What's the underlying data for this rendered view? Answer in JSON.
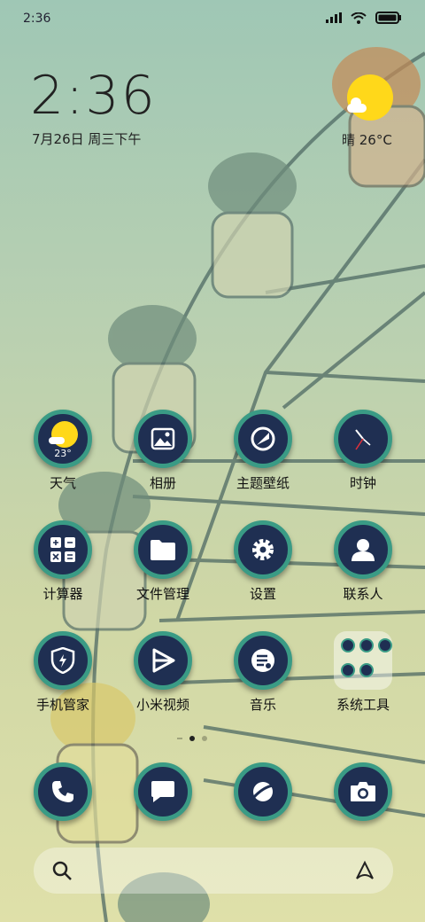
{
  "status_bar": {
    "time": "2:36"
  },
  "lockclock": {
    "time": "2:36",
    "date": "7月26日 周三下午"
  },
  "weather_widget": {
    "text": "晴 26°C"
  },
  "apps_row1": [
    {
      "label": "天气",
      "icon": "weather-icon",
      "temp": "23°"
    },
    {
      "label": "相册",
      "icon": "gallery-icon"
    },
    {
      "label": "主题壁纸",
      "icon": "themes-icon"
    },
    {
      "label": "时钟",
      "icon": "clock-icon"
    }
  ],
  "apps_row2": [
    {
      "label": "计算器",
      "icon": "calculator-icon"
    },
    {
      "label": "文件管理",
      "icon": "folder-icon"
    },
    {
      "label": "设置",
      "icon": "settings-icon"
    },
    {
      "label": "联系人",
      "icon": "contacts-icon"
    }
  ],
  "apps_row3": [
    {
      "label": "手机管家",
      "icon": "security-icon"
    },
    {
      "label": "小米视频",
      "icon": "video-icon"
    },
    {
      "label": "音乐",
      "icon": "music-icon"
    },
    {
      "label": "系统工具",
      "icon": "folder-tools-icon"
    }
  ],
  "dock": [
    {
      "icon": "phone-icon"
    },
    {
      "icon": "messages-icon"
    },
    {
      "icon": "browser-icon"
    },
    {
      "icon": "camera-icon"
    }
  ],
  "colors": {
    "icon_bg": "#1f2f52",
    "icon_ring": "#3a9b85",
    "sun": "#ffd81a"
  }
}
